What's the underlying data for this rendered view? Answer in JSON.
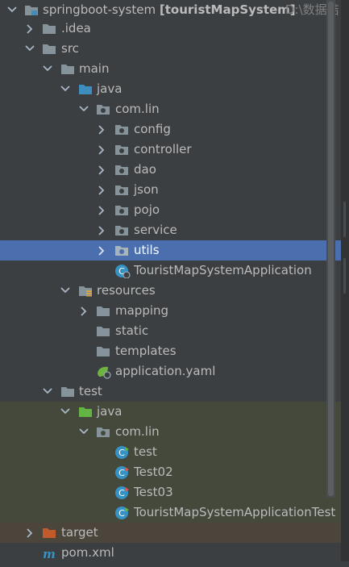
{
  "project": {
    "name": "springboot-system",
    "module": "[touristMapSystem]",
    "path": "D:\\数据结"
  },
  "nodes": {
    "idea": ".idea",
    "src": "src",
    "main": "main",
    "java_main": "java",
    "com_lin_main": "com.lin",
    "config": "config",
    "controller": "controller",
    "dao": "dao",
    "json": "json",
    "pojo": "pojo",
    "service": "service",
    "utils": "utils",
    "app_class": "TouristMapSystemApplication",
    "resources": "resources",
    "mapping": "mapping",
    "static": "static",
    "templates": "templates",
    "app_yaml": "application.yaml",
    "test": "test",
    "java_test": "java",
    "com_lin_test": "com.lin",
    "test_class": "test",
    "test02": "Test02",
    "test03": "Test03",
    "app_test_class": "TouristMapSystemApplicationTest",
    "target": "target",
    "pom": "pom.xml"
  },
  "colors": {
    "background": "#3c3f41",
    "selection": "#4b6eaf",
    "test_root_bg": "#45493c",
    "excluded_bg": "#4b453b",
    "folder": "#87939a",
    "source_folder": "#3d8dbf",
    "test_folder": "#62b543",
    "excluded_folder": "#c35a2c",
    "class_icon": "#3592c4"
  }
}
